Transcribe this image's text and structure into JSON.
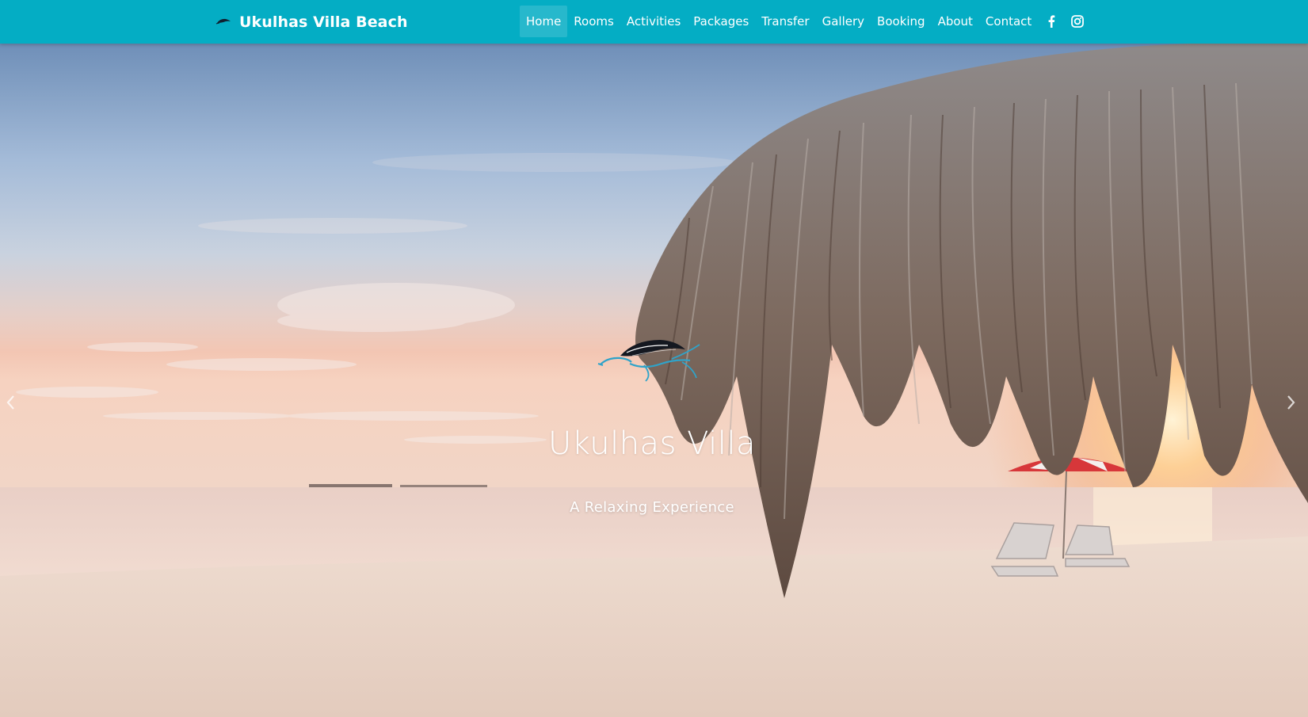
{
  "brand": {
    "name": "Ukulhas Villa Beach",
    "logo_icon": "turtle-icon"
  },
  "nav": {
    "items": [
      {
        "label": "Home",
        "active": true
      },
      {
        "label": "Rooms",
        "active": false
      },
      {
        "label": "Activities",
        "active": false
      },
      {
        "label": "Packages",
        "active": false
      },
      {
        "label": "Transfer",
        "active": false
      },
      {
        "label": "Gallery",
        "active": false
      },
      {
        "label": "Booking",
        "active": false
      },
      {
        "label": "About",
        "active": false
      },
      {
        "label": "Contact",
        "active": false
      }
    ],
    "social_icons": [
      "facebook-icon",
      "instagram-icon"
    ]
  },
  "hero": {
    "title": "Ukulhas Villa",
    "subtitle": "A Relaxing Experience",
    "image_icon": "beach-sunset-image",
    "prev_icon": "chevron-left-icon",
    "next_icon": "chevron-right-icon"
  },
  "colors": {
    "navbar_bg": "#04adc4",
    "text_on_nav": "#ffffff",
    "turtle_dark": "#141820",
    "turtle_blue": "#2fa3c9"
  }
}
